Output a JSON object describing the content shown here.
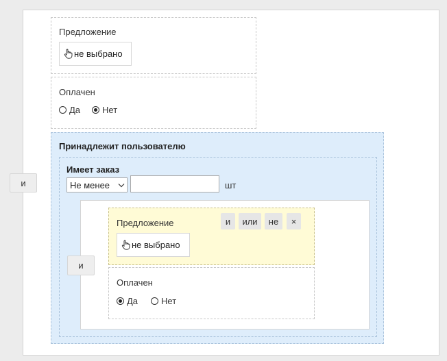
{
  "outer_and_button": "и",
  "cond_offer_top": {
    "label": "Предложение",
    "value": "не выбрано"
  },
  "cond_paid_top": {
    "label": "Оплачен",
    "options": [
      "Да",
      "Нет"
    ],
    "selected": "Нет"
  },
  "belongs": {
    "title": "Принадлежит пользователю",
    "has_order": {
      "title": "Имеет заказ",
      "comparator": "Не менее",
      "count_value": "",
      "unit": "шт"
    },
    "inner_and_button": "и",
    "cond_offer": {
      "label": "Предложение",
      "value": "не выбрано",
      "actions": [
        "и",
        "или",
        "не",
        "×"
      ]
    },
    "cond_paid": {
      "label": "Оплачен",
      "options": [
        "Да",
        "Нет"
      ],
      "selected": "Да"
    }
  },
  "colors": {
    "belongs_bg": "#deedfb",
    "highlight_bg": "#fffbd6"
  }
}
